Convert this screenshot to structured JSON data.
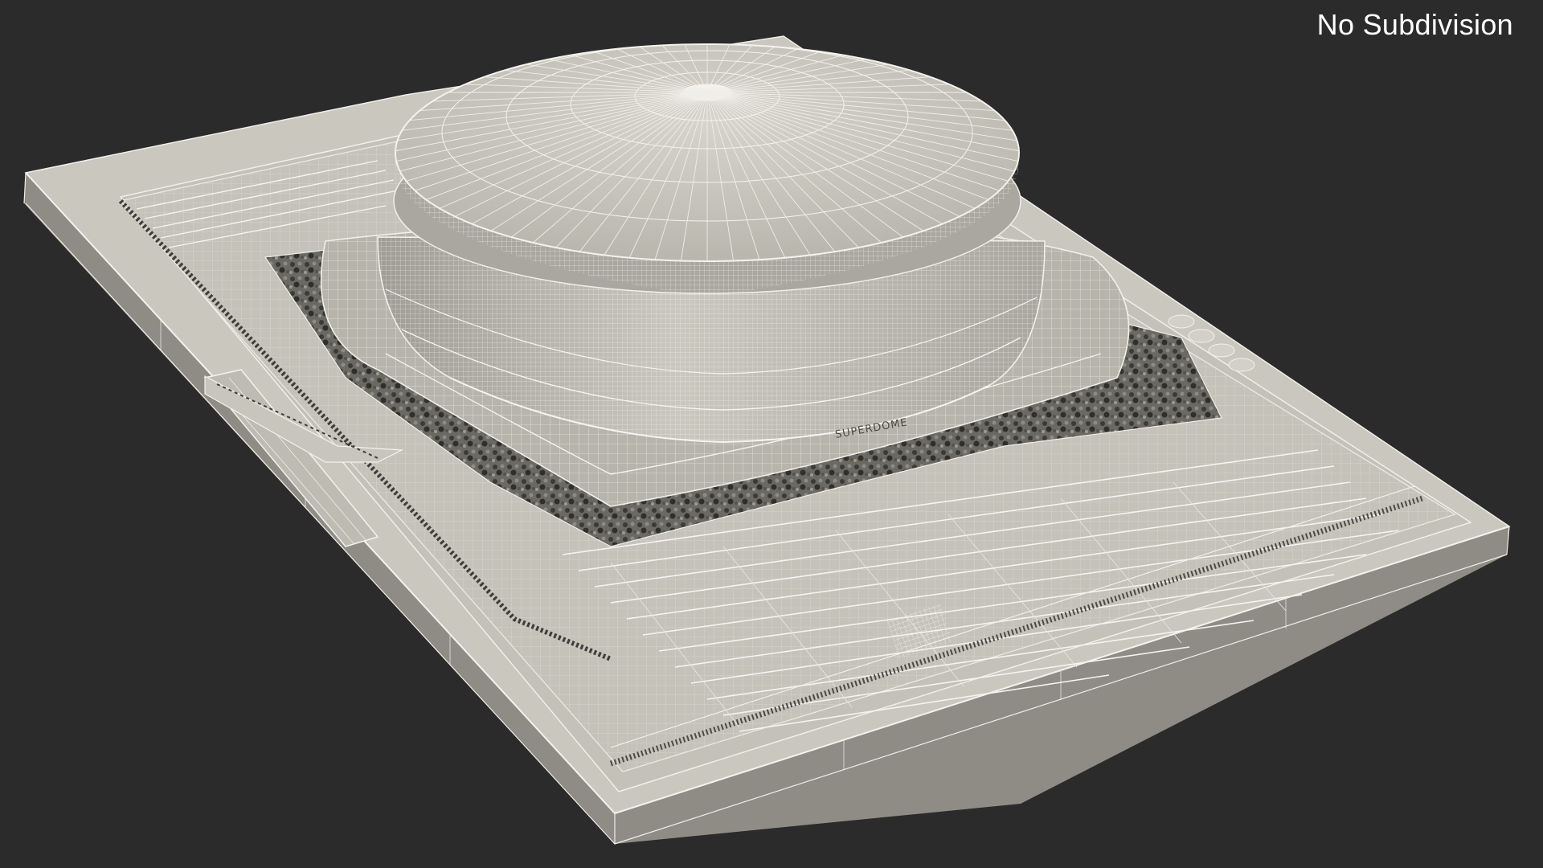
{
  "render": {
    "label": "No Subdivision",
    "background_color": "#2b2b2b",
    "model_color": "#c8c6bd",
    "wire_color": "#f4f3ee"
  },
  "scene": {
    "subject": "stadium-3d-model-wireframe",
    "dome_lettering": "SUPERDOME"
  }
}
